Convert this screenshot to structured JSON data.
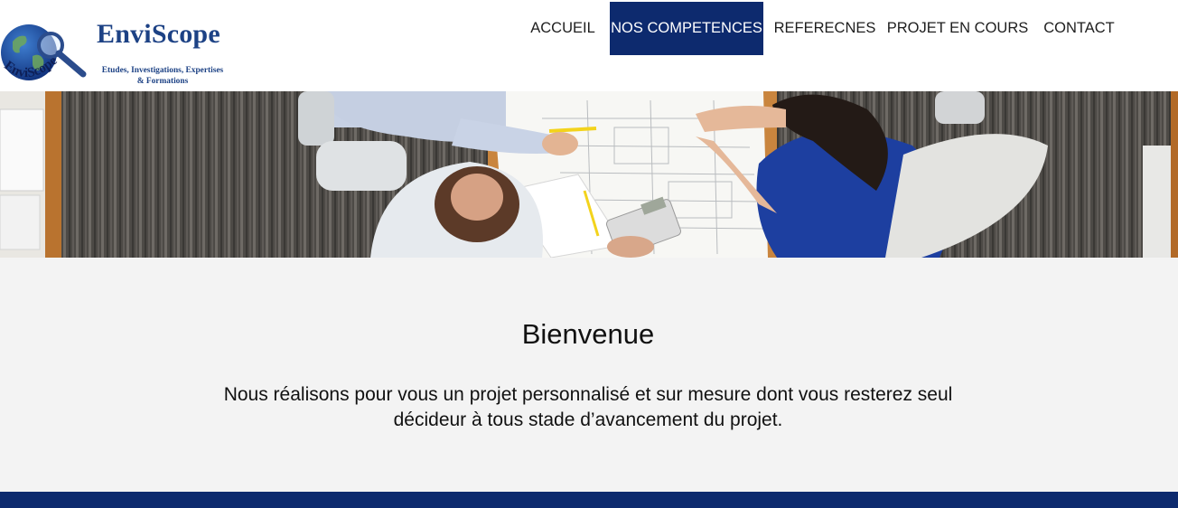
{
  "header": {
    "logo": {
      "title": "EnviScope",
      "tagline_line1": "Etudes, Investigations, Expertises",
      "tagline_line2": "& Formations",
      "emblem_text": "EnviScope"
    },
    "nav": [
      {
        "label": "ACCUEIL",
        "active": false
      },
      {
        "label": "NOS COMPETENCES",
        "active": true
      },
      {
        "label": "REFERECNES",
        "active": false
      },
      {
        "label": "PROJET EN COURS",
        "active": false
      },
      {
        "label": "CONTACT",
        "active": false
      }
    ]
  },
  "hero": {
    "image_subject": "people working on plans at a table, top view"
  },
  "welcome": {
    "title": "Bienvenue",
    "text": "Nous réalisons pour vous un projet personnalisé et sur mesure dont vous resterez seul décideur à tous stade d’avancement du projet."
  },
  "colors": {
    "brand_navy": "#0d2a6e",
    "logo_blue": "#1d4285",
    "background": "#f3f3f3"
  }
}
